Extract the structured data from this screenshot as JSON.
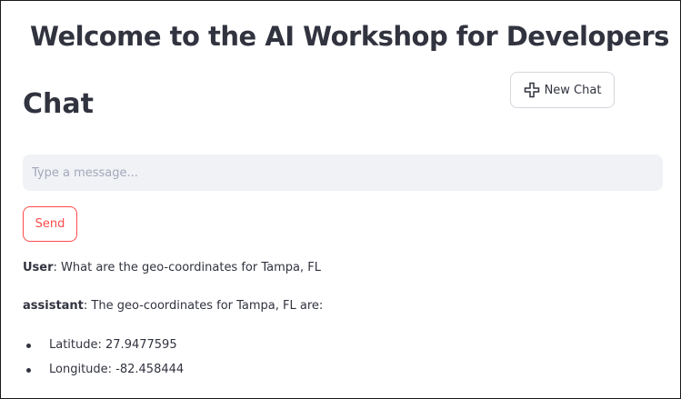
{
  "header": {
    "title": "Welcome to the AI Workshop for Developers"
  },
  "chat": {
    "section_title": "Chat",
    "new_chat_label": "New Chat",
    "input": {
      "placeholder": "Type a message...",
      "value": ""
    },
    "send_label": "Send",
    "messages": [
      {
        "role": "User",
        "separator": ":",
        "text": " What are the geo-coordinates for Tampa, FL"
      },
      {
        "role": "assistant",
        "separator": ":",
        "text": " The geo-coordinates for Tampa, FL are:",
        "bullets": [
          "Latitude: 27.9477595",
          "Longitude: -82.458444"
        ]
      }
    ]
  },
  "colors": {
    "primary": "#ff4b4b",
    "text": "#31333f",
    "input_background": "#f0f2f6",
    "button_border": "#d4d6dc"
  },
  "icons": {
    "new_chat": "plus-icon"
  }
}
